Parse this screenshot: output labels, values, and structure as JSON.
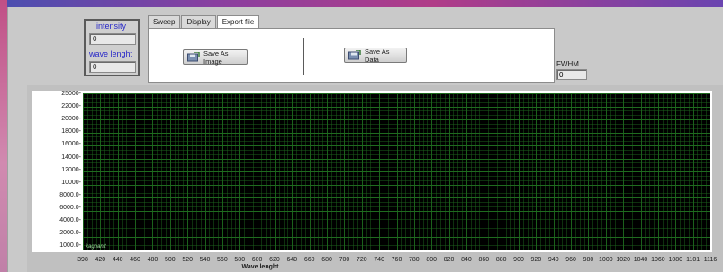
{
  "indicators": {
    "intensity": {
      "label": "intensity",
      "value": "0"
    },
    "wavelength": {
      "label": "wave lenght",
      "value": "0"
    }
  },
  "tabs": [
    "Sweep",
    "Display",
    "Export file"
  ],
  "active_tab": "Export file",
  "buttons": {
    "save_image": "Save As Image",
    "save_data": "Save As Data"
  },
  "fwhm": {
    "label": "FWHM",
    "value": "0"
  },
  "graph": {
    "plot_tag": "kaghanit",
    "y_ticks": [
      "25000-",
      "22000-",
      "20000-",
      "18000-",
      "16000-",
      "14000-",
      "12000-",
      "10000-",
      "8000.0-",
      "6000.0-",
      "4000.0-",
      "2000.0-",
      "1000.0-"
    ],
    "x_ticks": [
      "398",
      "420",
      "440",
      "460",
      "480",
      "500",
      "520",
      "540",
      "560",
      "580",
      "600",
      "620",
      "640",
      "660",
      "680",
      "700",
      "720",
      "740",
      "760",
      "780",
      "800",
      "820",
      "840",
      "860",
      "880",
      "900",
      "920",
      "940",
      "960",
      "980",
      "1000",
      "1020",
      "1040",
      "1060",
      "1080",
      "1101",
      "1116"
    ],
    "x_title": "Wave lenght"
  },
  "colors": {
    "plot_background": "#000000",
    "grid": "#1f6b1f",
    "indicator_label": "#2828c8"
  }
}
